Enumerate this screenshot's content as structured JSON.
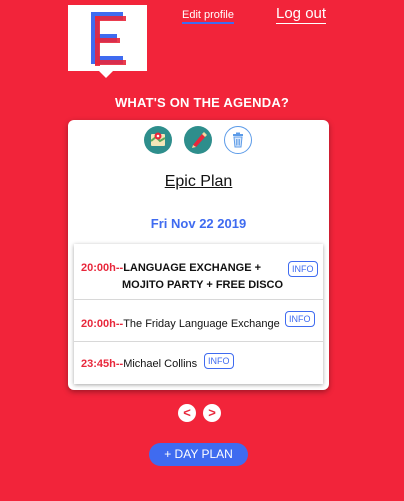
{
  "header": {
    "edit_profile": "Edit profile",
    "logout": "Log out"
  },
  "heading": "WHAT'S ON THE AGENDA?",
  "plan": {
    "title": "Epic Plan",
    "date": "Fri Nov 22 2019",
    "events": [
      {
        "time": "20:00h",
        "separator": "--",
        "name_line1": "LANGUAGE EXCHANGE +",
        "name_line2": "MOJITO PARTY + FREE DISCO",
        "info": "INFO"
      },
      {
        "time": "20:00h",
        "separator": "--",
        "name_line1": "The Friday Language Exchange",
        "info": "INFO"
      },
      {
        "time": "23:45h",
        "separator": "--",
        "name_line1": "Michael Collins",
        "info": "INFO"
      }
    ]
  },
  "pager": {
    "prev": "<",
    "next": ">"
  },
  "day_plan_button": "+ DAY PLAN",
  "colors": {
    "background": "#f2243a",
    "accent": "#3f6bf0",
    "time": "#e8273b",
    "icon_bg": "#2e8e8c"
  },
  "icons": [
    "map-icon",
    "edit-icon",
    "trash-icon"
  ]
}
